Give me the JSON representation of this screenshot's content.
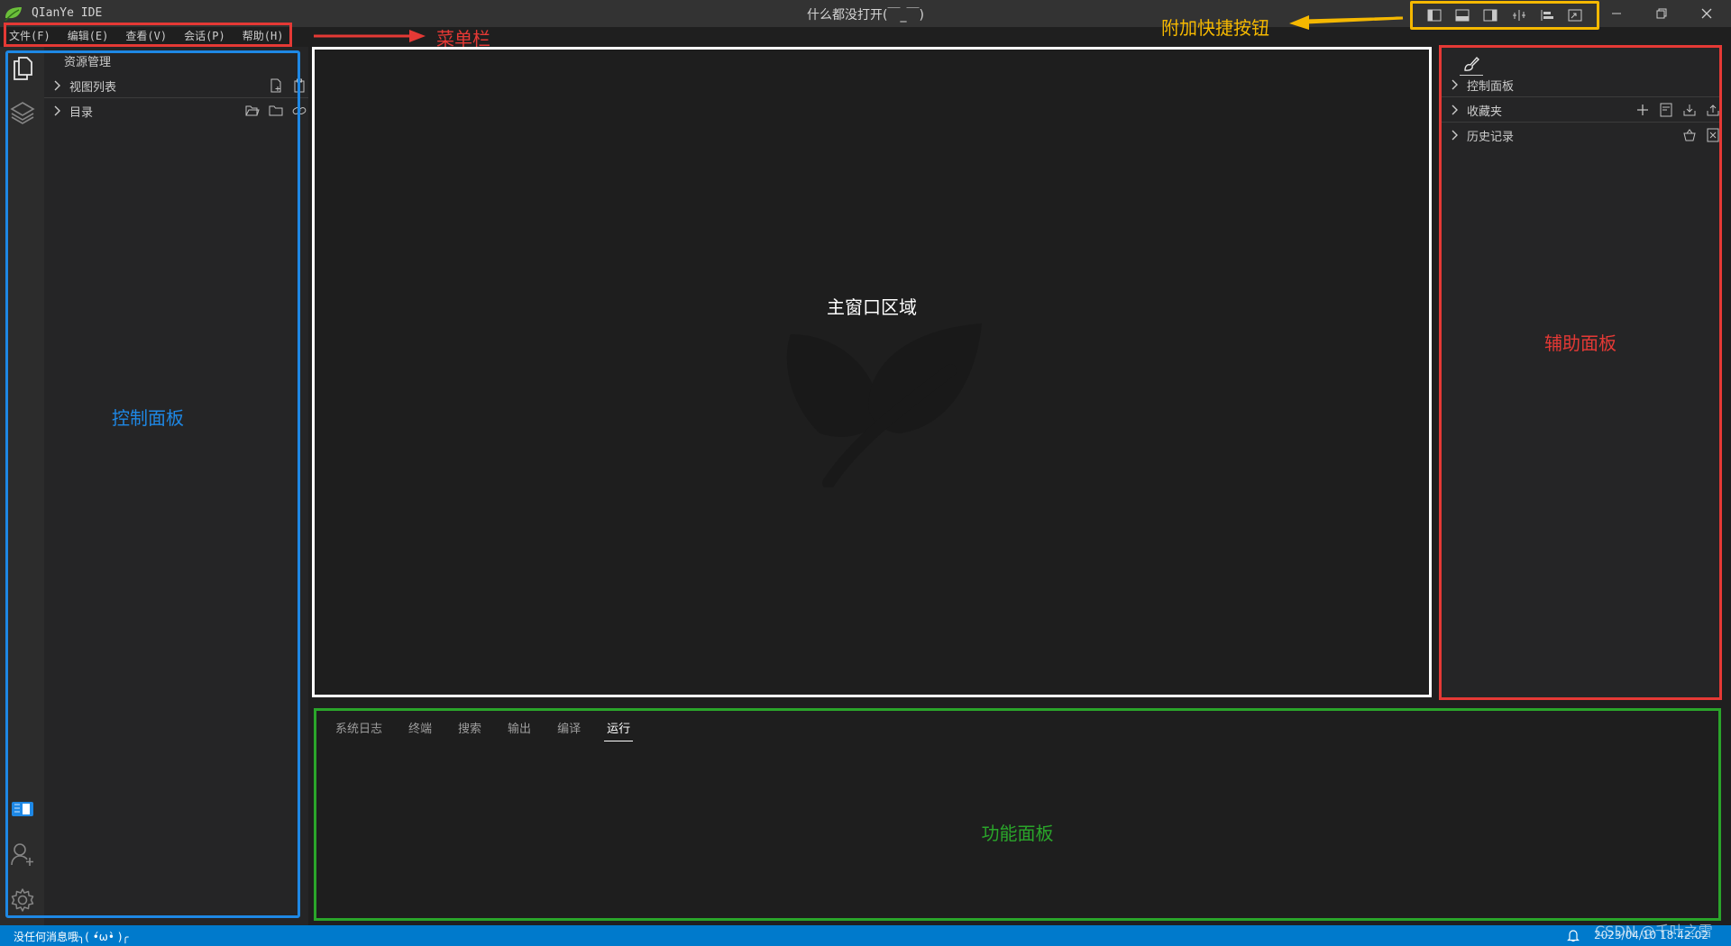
{
  "titlebar": {
    "app_name": "QIanYe IDE",
    "window_title": "什么都没打开(￣_￣)",
    "quick_buttons": [
      "toggle-left-panel-icon",
      "toggle-bottom-panel-icon",
      "toggle-right-panel-icon",
      "split-icon",
      "align-icon",
      "fullscreen-icon"
    ],
    "window_controls": [
      "minimize-icon",
      "restore-icon",
      "close-icon"
    ]
  },
  "menubar": {
    "items": [
      "文件(F)",
      "编辑(E)",
      "查看(V)",
      "会话(P)",
      "帮助(H)"
    ]
  },
  "activity_bar": {
    "top_icons": [
      "explorer-icon",
      "layers-icon"
    ],
    "bottom_icons": [
      "book-icon",
      "add-user-icon",
      "settings-icon"
    ]
  },
  "sidebar": {
    "title": "资源管理",
    "sections": [
      {
        "label": "视图列表",
        "actions": [
          "new-file-icon",
          "clipboard-icon"
        ]
      },
      {
        "label": "目录",
        "actions": [
          "open-folder-icon",
          "folder-icon",
          "link-icon"
        ]
      }
    ]
  },
  "editor": {
    "label": "主窗口区域",
    "watermark_icon": "leaf-logo-icon"
  },
  "aux_panel": {
    "top_icon": "brush-icon",
    "sections": [
      {
        "label": "控制面板",
        "actions": []
      },
      {
        "label": "收藏夹",
        "actions": [
          "add-icon",
          "save-list-icon",
          "import-icon",
          "export-icon"
        ]
      },
      {
        "label": "历史记录",
        "actions": [
          "basket-icon",
          "clear-icon"
        ]
      }
    ]
  },
  "bottom_panel": {
    "tabs": [
      "系统日志",
      "终端",
      "搜索",
      "输出",
      "编译",
      "运行"
    ],
    "active_tab": "运行"
  },
  "statusbar": {
    "message": "没任何消息哦╮( •́ω•̀ )╭",
    "time": "2023/04/10 18:42:02",
    "watermark": "CSDN @千叶之雪"
  },
  "annotations": {
    "menubar": "菜单栏",
    "quick_buttons": "附加快捷按钮",
    "control_panel": "控制面板",
    "aux_panel": "辅助面板",
    "function_panel": "功能面板"
  },
  "colors": {
    "annotation_red": "#e53935",
    "annotation_blue": "#1e88e5",
    "annotation_yellow": "#f5b800",
    "annotation_green": "#2aa52a",
    "statusbar": "#007acc"
  }
}
